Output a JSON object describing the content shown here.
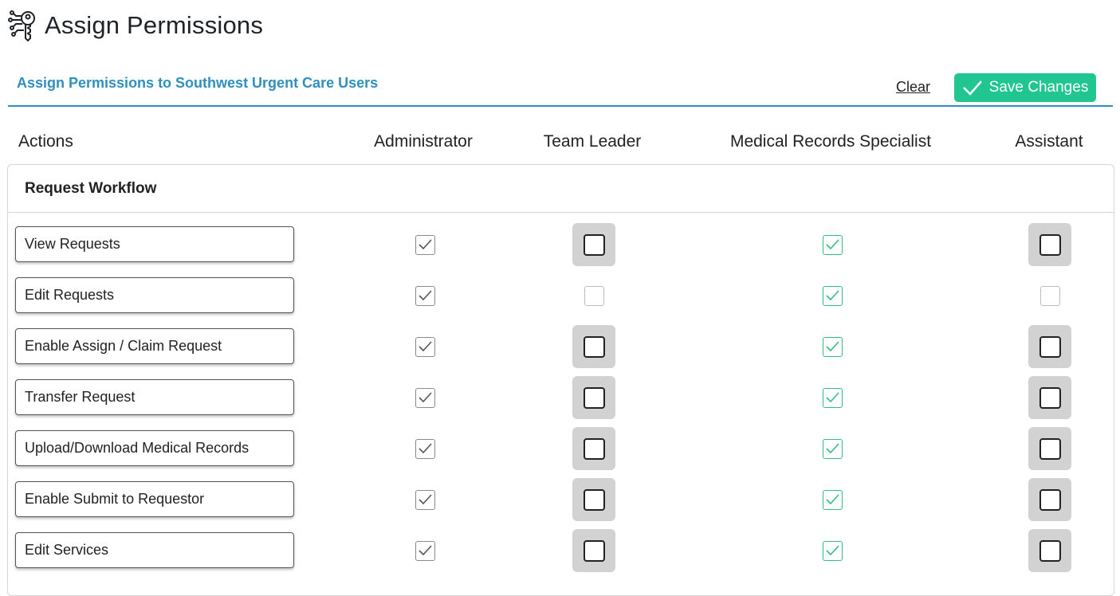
{
  "header": {
    "title": "Assign Permissions",
    "icon": "key-circuit-icon"
  },
  "subheader": {
    "title": "Assign Permissions to Southwest Urgent Care Users",
    "clear_label": "Clear",
    "save_label": "Save Changes"
  },
  "columns": {
    "actions": "Actions",
    "roles": [
      "Administrator",
      "Team Leader",
      "Medical Records Specialist",
      "Assistant"
    ]
  },
  "group": {
    "title": "Request Workflow",
    "rows": [
      {
        "label": "View Requests",
        "perms": [
          true,
          false,
          true,
          false
        ]
      },
      {
        "label": "Edit Requests",
        "perms": [
          true,
          false,
          true,
          false
        ]
      },
      {
        "label": "Enable Assign / Claim Request",
        "perms": [
          true,
          false,
          true,
          false
        ]
      },
      {
        "label": "Transfer Request",
        "perms": [
          true,
          false,
          true,
          false
        ]
      },
      {
        "label": "Upload/Download Medical Records",
        "perms": [
          true,
          false,
          true,
          false
        ]
      },
      {
        "label": "Enable Submit to Requestor",
        "perms": [
          true,
          false,
          true,
          false
        ]
      },
      {
        "label": "Edit Services",
        "perms": [
          true,
          false,
          true,
          false
        ]
      }
    ]
  },
  "colors": {
    "accent": "#2f8fbf",
    "save": "#20c58f",
    "check_green": "#2fbf80"
  }
}
